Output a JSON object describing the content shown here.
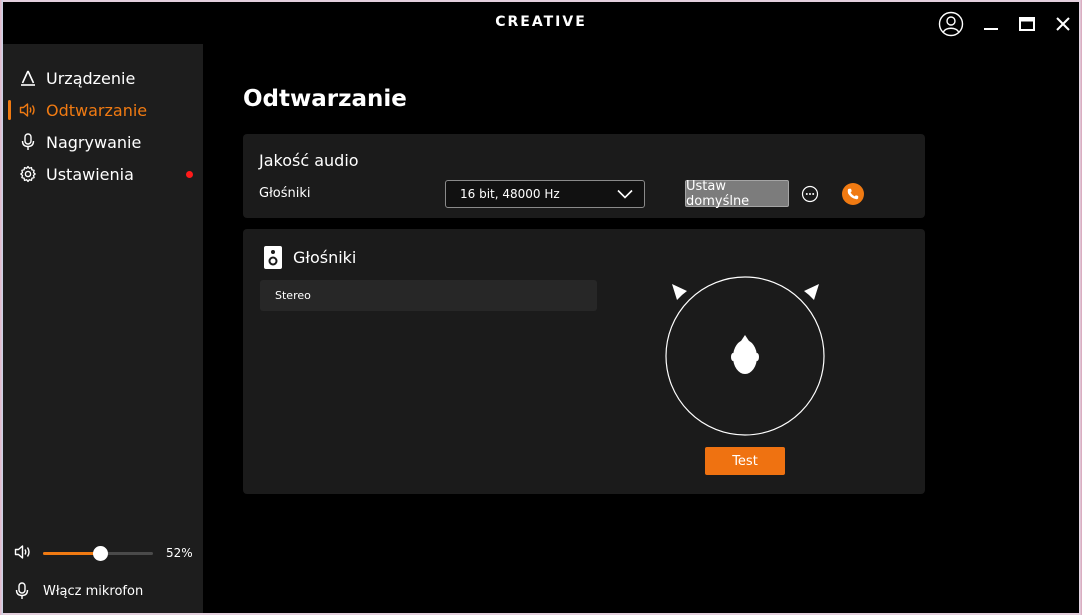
{
  "titlebar": {
    "brand": "CREATIVE",
    "icons": {
      "user": "user-circle-icon",
      "minimize": "minimize-icon",
      "maximize": "maximize-icon",
      "close": "close-icon"
    }
  },
  "sidebar": {
    "items": [
      {
        "label": "Urządzenie",
        "icon": "device-triangle-icon",
        "active": false
      },
      {
        "label": "Odtwarzanie",
        "icon": "speaker-icon",
        "active": true
      },
      {
        "label": "Nagrywanie",
        "icon": "microphone-icon",
        "active": false
      },
      {
        "label": "Ustawienia",
        "icon": "gear-icon",
        "active": false,
        "notification": true
      }
    ],
    "volume": {
      "percent": 52,
      "label": "52%"
    },
    "mic": {
      "label": "Włącz mikrofon"
    }
  },
  "main": {
    "title": "Odtwarzanie",
    "quality": {
      "title": "Jakość audio",
      "label": "Głośniki",
      "selected": "16 bit, 48000 Hz",
      "default_button": "Ustaw domyślne"
    },
    "speakers": {
      "title": "Głośniki",
      "mode": "Stereo",
      "test_button": "Test"
    }
  },
  "colors": {
    "accent": "#f07a12",
    "notification": "#ff1a1a"
  }
}
